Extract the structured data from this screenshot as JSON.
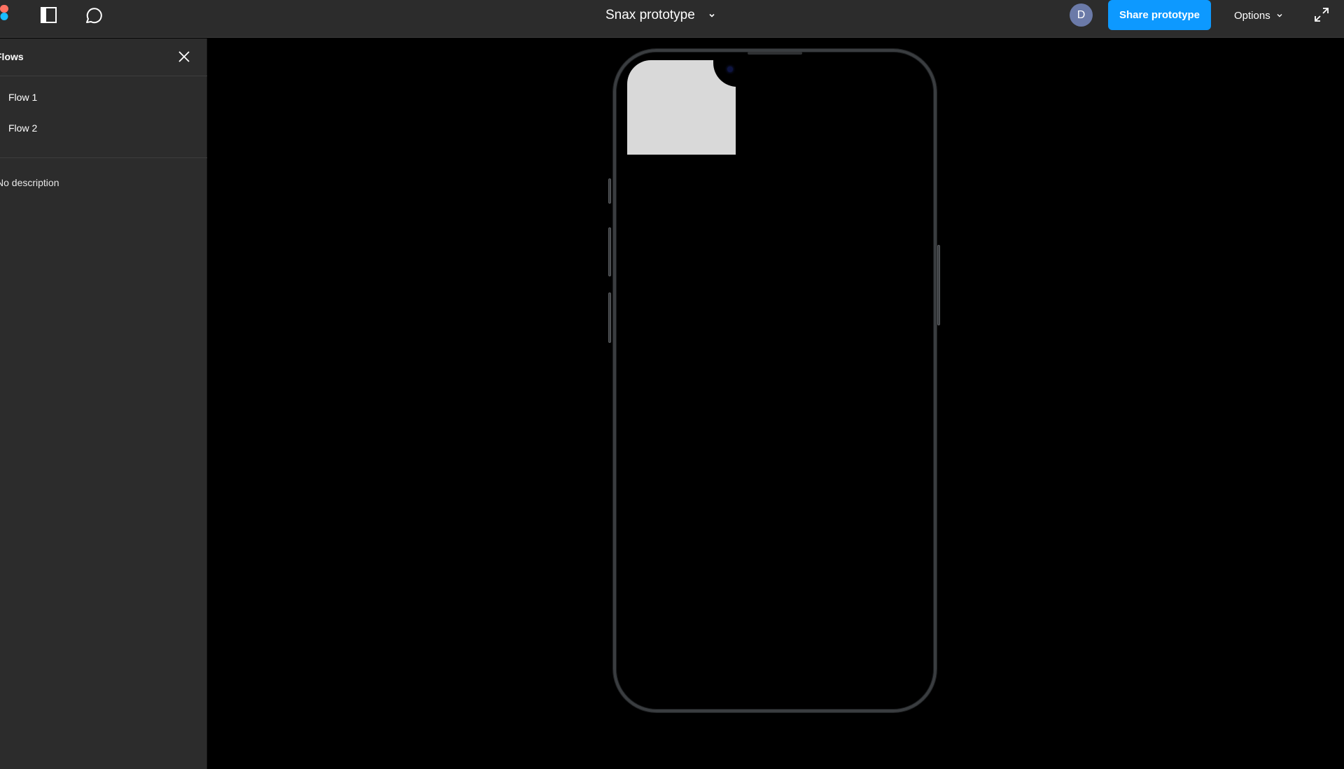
{
  "header": {
    "title": "Snax prototype",
    "avatar_initial": "D",
    "share_label": "Share prototype",
    "options_label": "Options",
    "icons": [
      "figma-logo",
      "panel-toggle-icon",
      "comment-icon",
      "chevron-down-icon",
      "expand-icon"
    ]
  },
  "sidebar": {
    "title": "Flows",
    "flows": [
      {
        "label": "Flow 1"
      },
      {
        "label": "Flow 2"
      }
    ],
    "description": "No description"
  },
  "colors": {
    "accent": "#0d99ff",
    "avatar": "#6b7aa8",
    "panel_bg": "#2c2c2c",
    "canvas_bg": "#000000",
    "frame_fill": "#d9d9d9"
  }
}
